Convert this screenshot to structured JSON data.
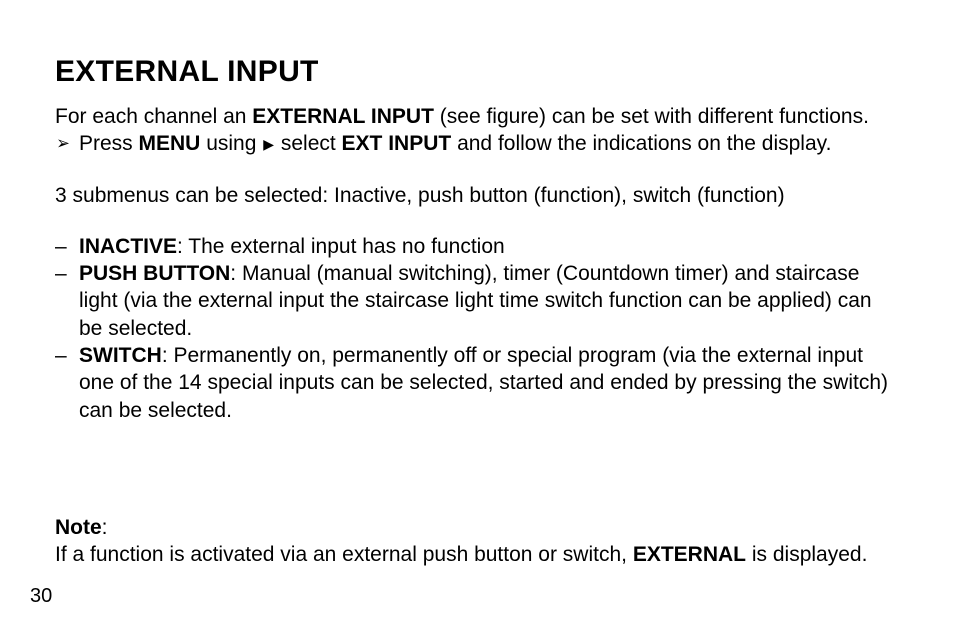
{
  "heading": "EXTERNAL INPUT",
  "intro_pre": "For each channel an ",
  "intro_bold": "EXTERNAL INPUT",
  "intro_post": " (see figure) can be set with different functions.",
  "instr_glyph": "➢",
  "instr_pre": "Press ",
  "instr_menu": "MENU",
  "instr_mid1": " using ",
  "instr_arrow": "▶",
  "instr_mid2": " select ",
  "instr_ext": "EXT INPUT",
  "instr_post": " and follow the indications on the display.",
  "submenus": "3 submenus can be selected: Inactive, push button (function), switch (function)",
  "dash": "–",
  "item1_bold": "INACTIVE",
  "item1_text": ": The external input has no function",
  "item2_bold": "PUSH BUTTON",
  "item2_text": ": Manual (manual switching), timer (Countdown timer) and staircase light (via the external input the staircase light time switch function can be applied) can be selected.",
  "item3_bold": "SWITCH",
  "item3_text": ": Permanently on, permanently off or special program (via the external input one of the 14 special inputs can be selected, started and ended by pressing the switch) can be selected.",
  "note_label": "Note",
  "note_colon": ":",
  "note_pre": "If a function is activated via an external push button or switch,  ",
  "note_bold": "EXTERNAL",
  "note_post": " is displayed.",
  "page_number": "30"
}
